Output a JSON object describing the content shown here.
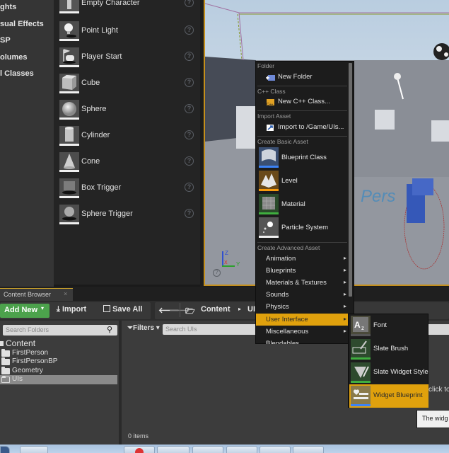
{
  "place_panel": {
    "categories": [
      "Lights",
      "Visual Effects",
      "BSP",
      "Volumes",
      "All Classes"
    ],
    "categories_visible": [
      "ghts",
      "sual Effects",
      "SP",
      "olumes",
      "l Classes"
    ],
    "items": [
      {
        "label": "Empty Character",
        "icon": "character-icon"
      },
      {
        "label": "Point Light",
        "icon": "light-bulb-icon"
      },
      {
        "label": "Player Start",
        "icon": "player-start-icon"
      },
      {
        "label": "Cube",
        "icon": "cube-icon"
      },
      {
        "label": "Sphere",
        "icon": "sphere-icon"
      },
      {
        "label": "Cylinder",
        "icon": "cylinder-icon"
      },
      {
        "label": "Cone",
        "icon": "cone-icon"
      },
      {
        "label": "Box Trigger",
        "icon": "box-trigger-icon"
      },
      {
        "label": "Sphere Trigger",
        "icon": "sphere-trigger-icon"
      }
    ],
    "help_glyph": "?"
  },
  "viewport": {
    "axis_labels": {
      "z": "Z",
      "y": "Y",
      "x": "X"
    },
    "help_glyph": "?",
    "watermark_text": "Pers"
  },
  "context_menu": {
    "sections": {
      "folder": "Folder",
      "cpp": "C++ Class",
      "import": "Import Asset",
      "basic": "Create Basic Asset",
      "advanced": "Create Advanced Asset"
    },
    "new_folder": "New Folder",
    "new_cpp_class": "New C++ Class...",
    "import_to": "Import to /Game/UIs...",
    "basic_assets": [
      {
        "label": "Blueprint Class",
        "color": "#3b82f6"
      },
      {
        "label": "Level",
        "color": "#f59a0c"
      },
      {
        "label": "Material",
        "color": "#3fae3f"
      },
      {
        "label": "Particle System",
        "color": "#f0f0f0"
      }
    ],
    "advanced_items": [
      {
        "label": "Animation",
        "highlighted": false
      },
      {
        "label": "Blueprints",
        "highlighted": false
      },
      {
        "label": "Materials & Textures",
        "highlighted": false
      },
      {
        "label": "Sounds",
        "highlighted": false
      },
      {
        "label": "Physics",
        "highlighted": false
      },
      {
        "label": "User Interface",
        "highlighted": true
      },
      {
        "label": "Miscellaneous",
        "highlighted": false
      },
      {
        "label": "Blendables",
        "highlighted": false
      }
    ],
    "arrow_glyph": "▸"
  },
  "submenu": {
    "items": [
      {
        "label": "Font",
        "color": "#555"
      },
      {
        "label": "Slate Brush",
        "color": "#3fae3f"
      },
      {
        "label": "Slate Widget Style",
        "color": "#3fae3f"
      },
      {
        "label": "Widget Blueprint",
        "color": "#3b82f6",
        "highlighted": true
      }
    ]
  },
  "content_browser": {
    "tab_label": "Content Browser",
    "tab_close": "×",
    "add_new": "Add New",
    "import": "Import",
    "save_all": "Save All",
    "breadcrumb": [
      "Content",
      "UIs"
    ],
    "breadcrumb_visible_tail": "UI",
    "search_folders_placeholder": "Search Folders",
    "filters_label": "Filters",
    "search_assets_placeholder": "Search UIs",
    "tree_root": "Content",
    "folders": [
      "FirstPerson",
      "FirstPersonBP",
      "Geometry",
      "UIs"
    ],
    "selected_folder": "UIs",
    "item_count": "0 items",
    "hint_text": "click to",
    "tooltip_text": "The widg"
  },
  "accent_colors": {
    "highlight": "#e0a10d",
    "add_new": "#4ca24c",
    "viewport_border": "#c48f1c"
  }
}
